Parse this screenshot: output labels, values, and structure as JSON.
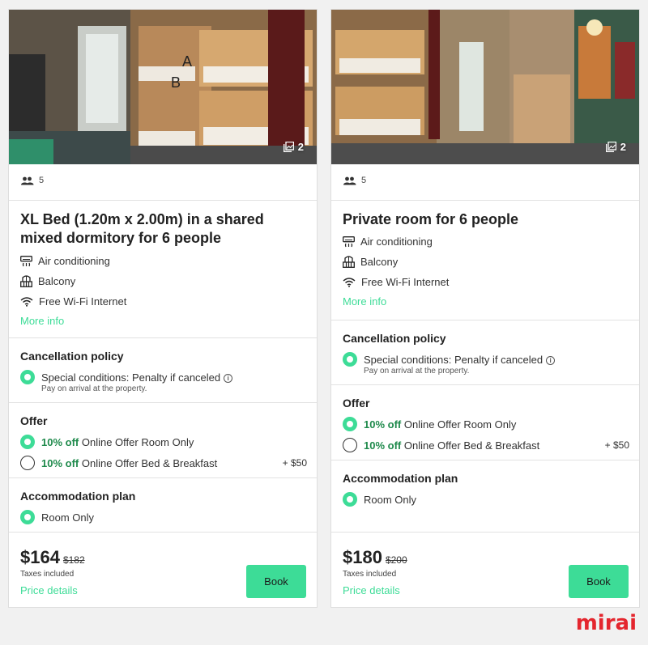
{
  "cards": [
    {
      "photo_count": "2",
      "occupancy": "5",
      "title_line1": "XL Bed (1.20m x 2.00m) in a shared",
      "title_line2": "mixed dormitory for 6 people",
      "features": [
        "Air conditioning",
        "Balcony",
        "Free Wi-Fi Internet"
      ],
      "feature_icons": [
        "air-conditioning-icon",
        "balcony-icon",
        "wifi-icon"
      ],
      "more_info": "More info",
      "cancellation": {
        "title": "Cancellation policy",
        "option": "Special conditions: Penalty if canceled",
        "note": "Pay on arrival at the property."
      },
      "offer": {
        "title": "Offer",
        "options": [
          {
            "discount": "10% off",
            "label": "Online Offer Room Only",
            "extra": "",
            "selected": true
          },
          {
            "discount": "10% off",
            "label": "Online Offer Bed & Breakfast",
            "extra": "+ $50",
            "selected": false
          }
        ]
      },
      "plan": {
        "title": "Accommodation plan",
        "option": "Room Only"
      },
      "price": "$164",
      "old_price": "$182",
      "taxes": "Taxes included",
      "price_details": "Price details",
      "book": "Book"
    },
    {
      "photo_count": "2",
      "occupancy": "5",
      "title_line1": "Private room for 6 people",
      "features": [
        "Air conditioning",
        "Balcony",
        "Free Wi-Fi Internet"
      ],
      "feature_icons": [
        "air-conditioning-icon",
        "balcony-icon",
        "wifi-icon"
      ],
      "more_info": "More info",
      "cancellation": {
        "title": "Cancellation policy",
        "option": "Special conditions: Penalty if canceled",
        "note": "Pay on arrival at the property."
      },
      "offer": {
        "title": "Offer",
        "options": [
          {
            "discount": "10% off",
            "label": "Online Offer Room Only",
            "extra": "",
            "selected": true
          },
          {
            "discount": "10% off",
            "label": "Online Offer Bed & Breakfast",
            "extra": "+ $50",
            "selected": false
          }
        ]
      },
      "plan": {
        "title": "Accommodation plan",
        "option": "Room Only"
      },
      "price": "$180",
      "old_price": "$200",
      "taxes": "Taxes included",
      "price_details": "Price details",
      "book": "Book"
    }
  ],
  "brand": "mirai",
  "colors": {
    "accent": "#3ddc97",
    "discount": "#1f8a4c",
    "brand": "#e4262e"
  }
}
